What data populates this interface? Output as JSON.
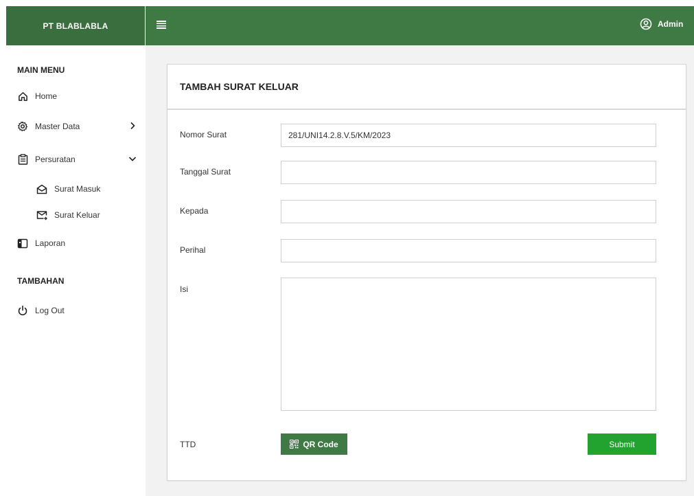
{
  "app": {
    "brand": "PT BLABLABLA"
  },
  "header": {
    "user_label": "Admin"
  },
  "sidebar": {
    "main_heading": "MAIN MENU",
    "items": [
      {
        "label": "Home",
        "icon": "home-icon"
      },
      {
        "label": "Master Data",
        "icon": "gear-icon"
      },
      {
        "label": "Persuratan",
        "icon": "clipboard-icon"
      },
      {
        "label": "Laporan",
        "icon": "report-icon"
      }
    ],
    "submenu": [
      {
        "label": "Surat Masuk",
        "icon": "envelope-open-icon"
      },
      {
        "label": "Surat Keluar",
        "icon": "envelope-send-icon"
      }
    ],
    "extra_heading": "TAMBAHAN",
    "logout_label": "Log Out"
  },
  "form": {
    "title": "TAMBAH SURAT KELUAR",
    "nomor_label": "Nomor Surat",
    "nomor_value": "281/UNI14.2.8.V.5/KM/2023",
    "tanggal_label": "Tanggal Surat",
    "tanggal_value": "",
    "kepada_label": "Kepada",
    "kepada_value": "",
    "perihal_label": "Perihal",
    "perihal_value": "",
    "isi_label": "Isi",
    "isi_value": "",
    "ttd_label": "TTD",
    "qr_label": "QR Code",
    "submit_label": "Submit"
  },
  "colors": {
    "header_green": "#3f7a44",
    "brand_green": "#3a6e3f",
    "submit_green": "#22a22e",
    "content_bg": "#f2f2f2"
  }
}
